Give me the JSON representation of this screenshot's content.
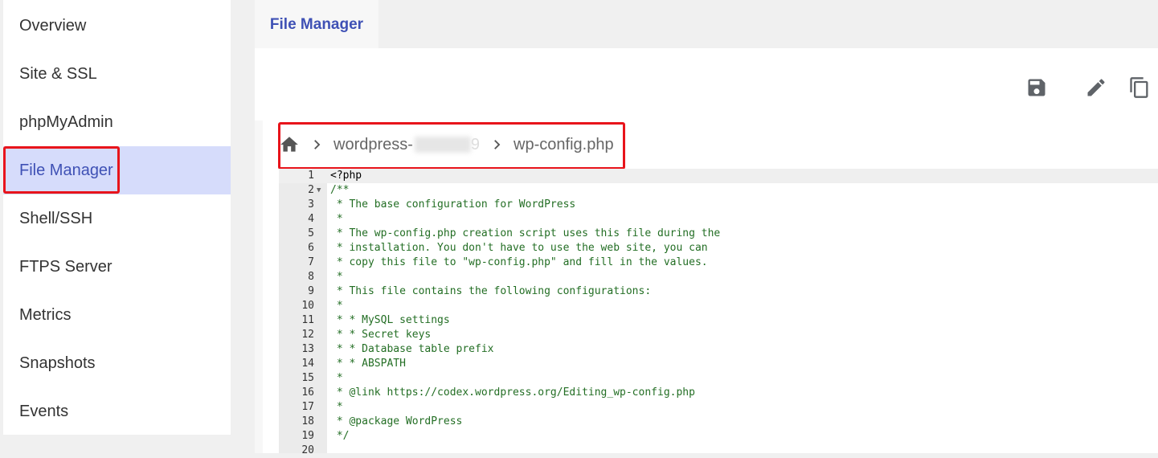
{
  "sidebar": {
    "items": [
      {
        "label": "Overview",
        "active": false
      },
      {
        "label": "Site & SSL",
        "active": false
      },
      {
        "label": "phpMyAdmin",
        "active": false
      },
      {
        "label": "File Manager",
        "active": true
      },
      {
        "label": "Shell/SSH",
        "active": false
      },
      {
        "label": "FTPS Server",
        "active": false
      },
      {
        "label": "Metrics",
        "active": false
      },
      {
        "label": "Snapshots",
        "active": false
      },
      {
        "label": "Events",
        "active": false
      }
    ]
  },
  "main": {
    "tab": "File Manager",
    "toolbar": {
      "icons": [
        "save-icon",
        "edit-icon",
        "copy-icon"
      ]
    },
    "breadcrumb": {
      "home_icon": "home-icon",
      "folder": "wordpress-",
      "folder_suffix": "9",
      "file": "wp-config.php"
    },
    "editor": {
      "lines": [
        "<?php",
        "/**",
        " * The base configuration for WordPress",
        " *",
        " * The wp-config.php creation script uses this file during the",
        " * installation. You don't have to use the web site, you can",
        " * copy this file to \"wp-config.php\" and fill in the values.",
        " *",
        " * This file contains the following configurations:",
        " *",
        " * * MySQL settings",
        " * * Secret keys",
        " * * Database table prefix",
        " * * ABSPATH",
        " *",
        " * @link https://codex.wordpress.org/Editing_wp-config.php",
        " *",
        " * @package WordPress",
        " */",
        ""
      ],
      "line_numbers": [
        "1",
        "2",
        "3",
        "4",
        "5",
        "6",
        "7",
        "8",
        "9",
        "10",
        "11",
        "12",
        "13",
        "14",
        "15",
        "16",
        "17",
        "18",
        "19",
        "20"
      ]
    }
  },
  "colors": {
    "accent": "#3f51b5",
    "active_bg": "#d6dcfb",
    "highlight_box": "#e8141b",
    "comment": "#236e24"
  }
}
